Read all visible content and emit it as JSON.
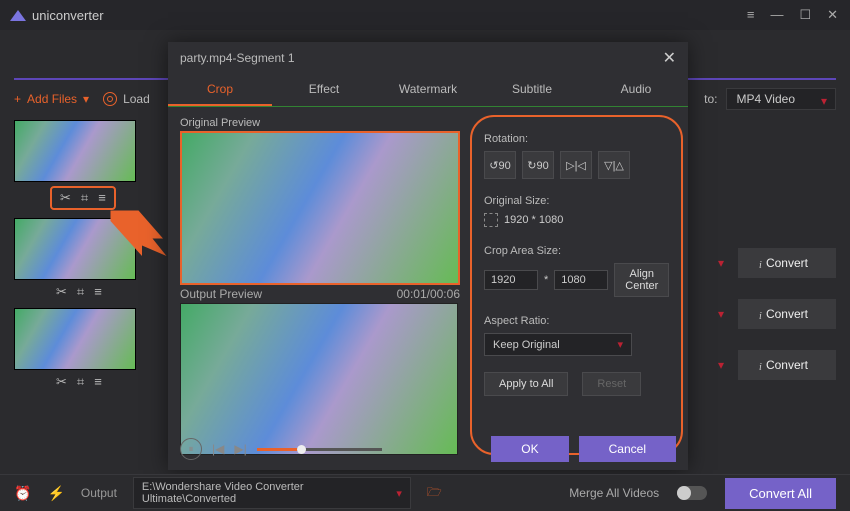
{
  "brand": "uniconverter",
  "actionbar": {
    "addFiles": "Add Files",
    "loadDvd": "Load"
  },
  "outputFormat": {
    "to": "to:",
    "value": "MP4 Video"
  },
  "rightCol": {
    "convert": "Convert"
  },
  "bottom": {
    "outputLabel": "Output",
    "path": "E:\\Wondershare Video Converter Ultimate\\Converted",
    "mergeAll": "Merge All Videos",
    "convertAll": "Convert All"
  },
  "modal": {
    "title": "party.mp4-Segment 1",
    "tabs": {
      "crop": "Crop",
      "effect": "Effect",
      "watermark": "Watermark",
      "subtitle": "Subtitle",
      "audio": "Audio"
    },
    "originalPreview": "Original Preview",
    "outputPreview": "Output Preview",
    "timecode": "00:01/00:06",
    "rotation": "Rotation:",
    "origSize": "Original Size:",
    "origValue": "1920 * 1080",
    "cropArea": "Crop Area Size:",
    "cropW": "1920",
    "cropH": "1080",
    "alignCenter": "Align Center",
    "aspect": "Aspect Ratio:",
    "aspectValue": "Keep Original",
    "applyAll": "Apply to All",
    "reset": "Reset",
    "ok": "OK",
    "cancel": "Cancel",
    "rotBtns": {
      "left": "↺90",
      "right": "↻90",
      "flipH": "▷|◁",
      "flipV": "▽|△"
    }
  },
  "icons": {
    "scissors": "✂",
    "crop": "⌗",
    "sliders": "≡",
    "play": "▶",
    "download": "⬇",
    "record": "⬤",
    "device": "🖴",
    "tools": "🛠",
    "caret": "▾",
    "close": "✕",
    "prev": "|◀",
    "next": "▶|",
    "pause": "⏸",
    "alarm": "⏰",
    "flash": "⚡",
    "folder": "🗁",
    "info": "i",
    "star": "*"
  }
}
